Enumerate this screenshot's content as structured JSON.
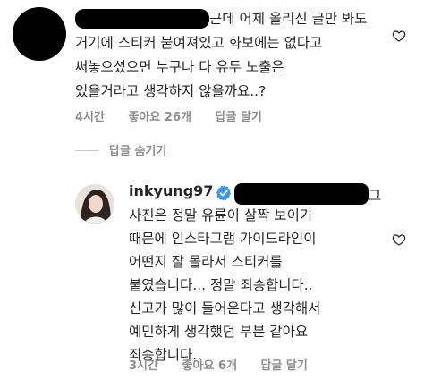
{
  "comments": [
    {
      "text": "근데 어제 올리신 글만 봐도\n거기에 스티커 붙여져있고 화보에는 없다고\n써놓으셨으면 누구나 다 유두 노출은\n있을거라고 생각하지 않을까요..?",
      "time": "4시간",
      "likes": "좋아요 26개",
      "reply": "답글 달기"
    }
  ],
  "hide_replies": "답글 숨기기",
  "reply": {
    "username": "inkyung97",
    "tail": "그",
    "text": "사진은 정말 유륜이 살짝 보이기\n때문에 인스타그램 가이드라인이\n어떤지 잘 몰라서 스티커를\n붙였습니다... 정말 죄송합니다..\n신고가 많이 들어온다고 생각해서\n예민하게 생각했던 부분 같아요\n죄송합니다..",
    "time": "3시간",
    "likes": "좋아요 6개",
    "reply": "답글 달기"
  },
  "colors": {
    "text": "#262626",
    "meta": "#8e8e8e",
    "verified": "#3897f0"
  },
  "icons": {
    "like": "heart-icon",
    "verified": "verified-badge-icon"
  }
}
